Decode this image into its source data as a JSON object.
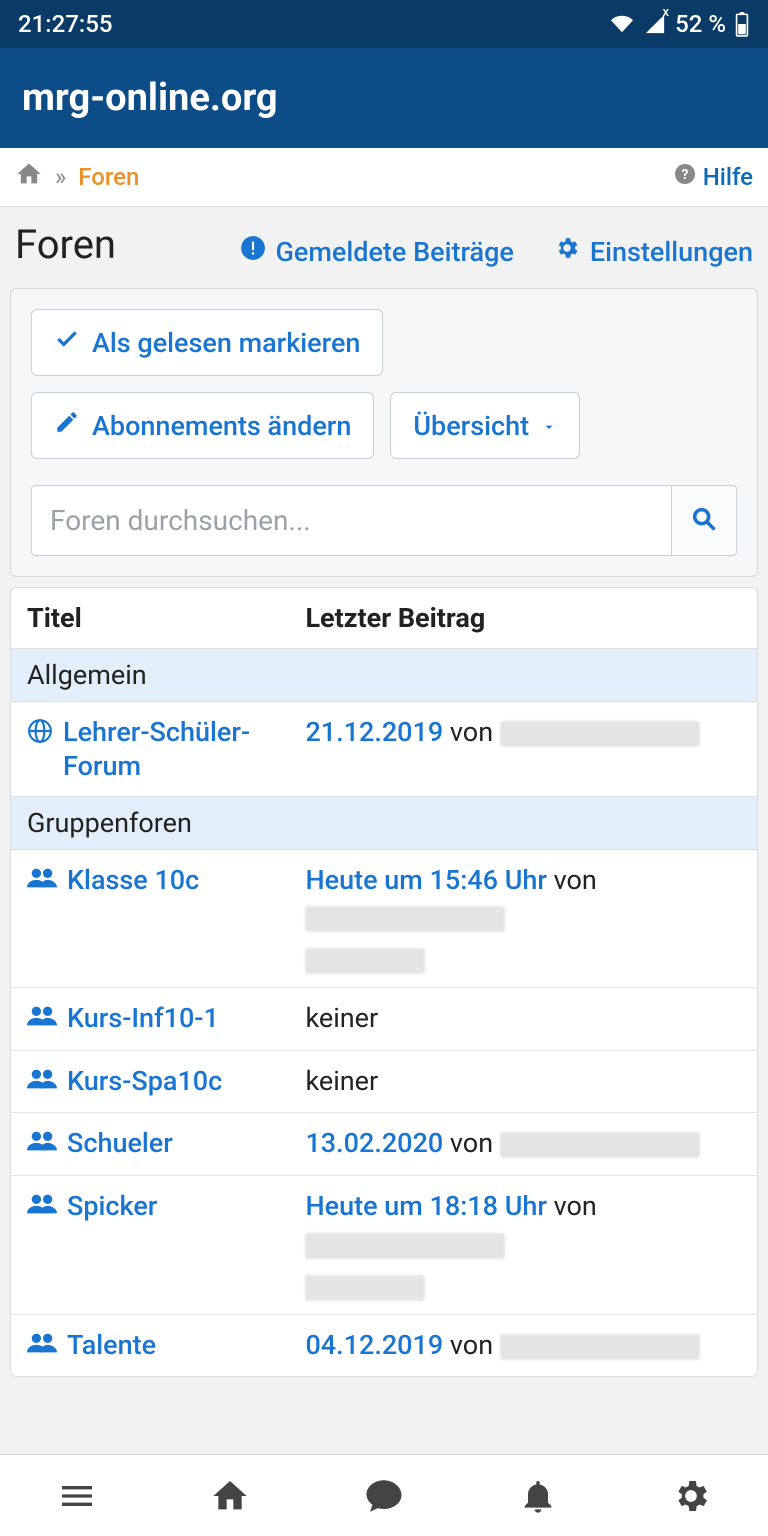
{
  "status": {
    "time": "21:27:55",
    "battery": "52 %",
    "signal_sup": "x"
  },
  "app": {
    "title": "mrg-online.org"
  },
  "breadcrumb": {
    "current": "Foren",
    "help": "Hilfe"
  },
  "page": {
    "title": "Foren",
    "links": {
      "reported": "Gemeldete Beiträge",
      "settings": "Einstellungen"
    }
  },
  "toolbar": {
    "mark_read": "Als gelesen markieren",
    "subscriptions": "Abonnements ändern",
    "overview": "Übersicht"
  },
  "search": {
    "placeholder": "Foren durchsuchen..."
  },
  "table": {
    "headers": {
      "title": "Titel",
      "last": "Letzter Beitrag"
    },
    "sections": [
      {
        "label": "Allgemein",
        "forums": [
          {
            "icon": "globe",
            "name": "Lehrer-Schüler-Forum",
            "date": "21.12.2019",
            "from": "von",
            "by_redacted": true
          }
        ]
      },
      {
        "label": "Gruppenforen",
        "forums": [
          {
            "icon": "group",
            "name": "Klasse 10c",
            "date": "Heute um 15:46 Uhr",
            "from": "von",
            "by_redacted": true,
            "second_line_redacted": true
          },
          {
            "icon": "group",
            "name": "Kurs-Inf10-1",
            "none": "keiner"
          },
          {
            "icon": "group",
            "name": "Kurs-Spa10c",
            "none": "keiner"
          },
          {
            "icon": "group",
            "name": "Schueler",
            "date": "13.02.2020",
            "from": "von",
            "by_redacted": true
          },
          {
            "icon": "group",
            "name": "Spicker",
            "date": "Heute um 18:18 Uhr",
            "from": "von",
            "by_redacted": true,
            "second_line_redacted": true
          },
          {
            "icon": "group",
            "name": "Talente",
            "date": "04.12.2019",
            "from": "von",
            "by_redacted": true
          }
        ]
      }
    ]
  }
}
